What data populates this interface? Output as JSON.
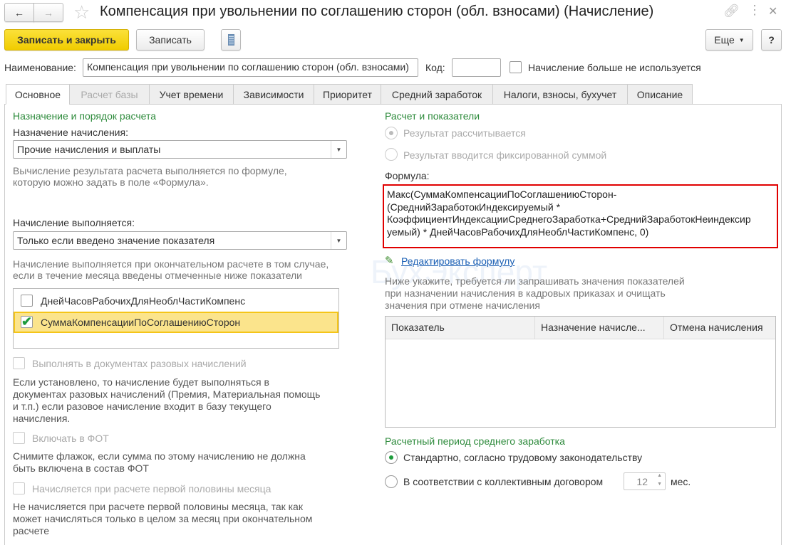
{
  "window": {
    "title": "Компенсация при увольнении по соглашению сторон (обл. взносами) (Начисление)"
  },
  "toolbar": {
    "save_close": "Записать и закрыть",
    "save": "Записать",
    "more": "Еще",
    "help": "?"
  },
  "header": {
    "name_label": "Наименование:",
    "name_value": "Компенсация при увольнении по соглашению сторон (обл. взносами)",
    "code_label": "Код:",
    "code_value": "",
    "unused_label": "Начисление больше не используется"
  },
  "tabs": [
    "Основное",
    "Расчет базы",
    "Учет времени",
    "Зависимости",
    "Приоритет",
    "Средний заработок",
    "Налоги, взносы, бухучет",
    "Описание"
  ],
  "left": {
    "section_title": "Назначение и порядок расчета",
    "purpose_label": "Назначение начисления:",
    "purpose_value": "Прочие начисления и выплаты",
    "purpose_hint": [
      "Вычисление результата расчета выполняется по формуле,",
      "которую можно задать в поле «Формула»."
    ],
    "exec_label": "Начисление выполняется:",
    "exec_value": "Только если введено значение показателя",
    "exec_hint": [
      "Начисление выполняется при окончательном расчете в том случае,",
      "если в течение месяца введены отмеченные ниже показатели"
    ],
    "indicators": [
      {
        "name": "ДнейЧасовРабочихДляНеоблЧастиКомпенс",
        "checked": false
      },
      {
        "name": "СуммаКомпенсацииПоСоглашениюСторон",
        "checked": true
      }
    ],
    "one_time_label": "Выполнять в документах разовых начислений",
    "one_time_hint": [
      "Если установлено, то начисление будет выполняться в",
      "документах разовых начислений (Премия, Материальная помощь",
      "и т.п.) если разовое начисление входит в базу текущего",
      "начисления."
    ],
    "fot_label": "Включать в ФОТ",
    "fot_hint": [
      "Снимите флажок, если сумма по этому начислению не должна",
      "быть включена в состав ФОТ"
    ],
    "half_label": "Начисляется при расчете первой половины месяца",
    "half_hint": [
      "Не начисляется при расчете первой половины месяца, так как",
      "может начисляться только в целом за месяц при окончательном",
      "расчете"
    ]
  },
  "right": {
    "section_title": "Расчет и показатели",
    "radio_calc": "Результат рассчитывается",
    "radio_fixed": "Результат вводится фиксированной суммой",
    "formula_label": "Формула:",
    "formula_lines": [
      "Макс(СуммаКомпенсацииПоСоглашениюСторон-",
      "(СреднийЗаработокИндексируемый *",
      "КоэффициентИндексацииСреднегоЗаработка+СреднийЗаработокНеиндексир",
      "уемый) * ДнейЧасовРабочихДляНеоблЧастиКомпенс, 0)"
    ],
    "edit_formula": "Редактировать формулу",
    "hint": [
      "Ниже укажите, требуется ли запрашивать значения показателей",
      "при назначении начисления в кадровых приказах и очищать",
      "значения при отмене начисления"
    ],
    "table_headers": [
      "Показатель",
      "Назначение начисле...",
      "Отмена начисления"
    ],
    "avg_title": "Расчетный период среднего заработка",
    "avg_standard": "Стандартно, согласно трудовому законодательству",
    "avg_collective": "В соответствии с коллективным договором",
    "months_value": "12",
    "months_unit": "мес."
  },
  "watermark": "БухЭксперт",
  "colors": {
    "accent_yellow": "#f5d400",
    "green": "#2e8b3c",
    "link": "#1a5fb4",
    "highlight": "#fbe48c",
    "formula_border": "#e00000"
  }
}
